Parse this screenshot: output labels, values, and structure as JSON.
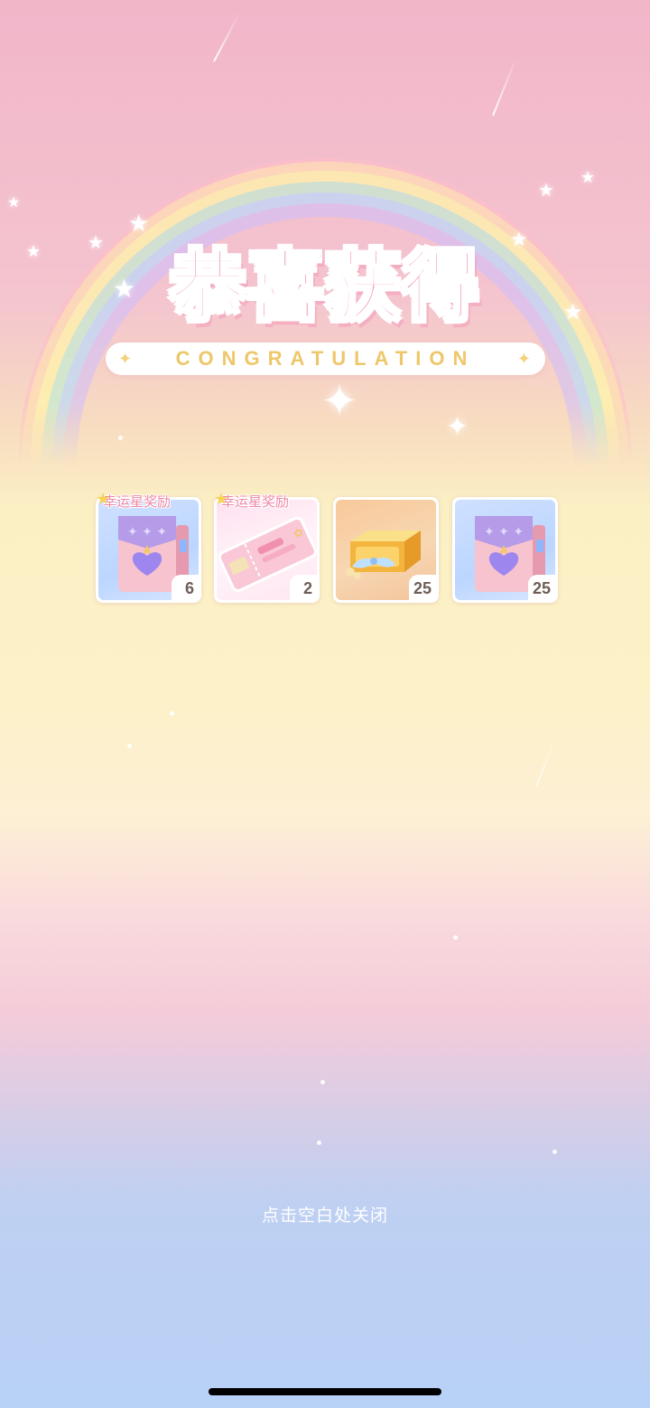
{
  "popup": {
    "title": "恭喜获得",
    "subtitle": "CONGRATULATION",
    "close_hint": "点击空白处关闭"
  },
  "rewards": [
    {
      "item": "purple-heart-bag",
      "count": "6",
      "badge": "幸运星奖励"
    },
    {
      "item": "pink-ticket",
      "count": "2",
      "badge": "幸运星奖励"
    },
    {
      "item": "golden-gift-box",
      "count": "25",
      "badge": ""
    },
    {
      "item": "purple-heart-bag",
      "count": "25",
      "badge": ""
    }
  ],
  "colors": {
    "title": "#ec84a8",
    "subtitle": "#eec76a",
    "badge_text": "#ef88a6",
    "count_text": "#6f5d56",
    "close_hint": "#ffffff"
  }
}
